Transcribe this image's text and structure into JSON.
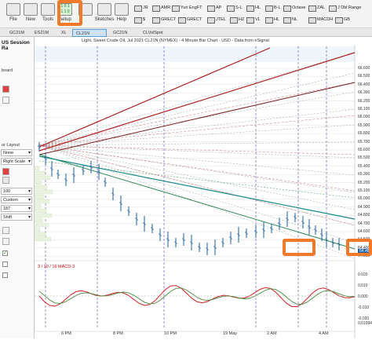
{
  "toolbar": {
    "buttons": [
      {
        "key": "file",
        "label": "File"
      },
      {
        "key": "new",
        "label": "New"
      },
      {
        "key": "tools",
        "label": "Tools"
      },
      {
        "key": "setup",
        "label": "Setup"
      },
      {
        "key": "sketch",
        "label": "Sketches"
      },
      {
        "key": "help",
        "label": "Help"
      }
    ],
    "tools_row1": [
      "JR",
      "AMR",
      "Yuri EngFT",
      "AP",
      "S-L",
      "HL",
      "B-L",
      "Octave",
      "ZAL",
      "J Dbl Range"
    ],
    "tools_row2": [
      "$",
      "GRECT",
      "GRECT",
      "JTEL",
      "HZ",
      "VL",
      "HL",
      "NL",
      "MACDH",
      "GB"
    ],
    "highlight_icon_text": "1 0 1\n1 1 0"
  },
  "tabs": [
    "GC21M",
    "ES21M",
    "XL",
    "CL21N",
    "GC21N",
    "CLVolSpot"
  ],
  "active_tab": "CL21N",
  "left_panel": {
    "title": "US Session Ra",
    "rows": [
      "board",
      "or Layout",
      "None",
      "Right Scale",
      "100",
      "Custom",
      "187",
      "Shift"
    ]
  },
  "chart": {
    "title": "Light, Sweet Crude Oil, Jul 2021 CL21N (NYMEX) - 4 Minute Bar Chart - USD - Data from eSignal",
    "price_labels": [
      "66.600",
      "66.500",
      "66.400",
      "66.300",
      "66.200",
      "66.100",
      "66.000",
      "65.900",
      "65.800",
      "65.700",
      "65.600",
      "65.500",
      "65.400",
      "65.300",
      "65.200",
      "65.100",
      "65.000",
      "64.900",
      "64.800",
      "64.700",
      "64.600",
      "64.500",
      "64.400",
      "64.300"
    ],
    "current_price": "64.48",
    "time_labels": [
      "6 PM",
      "8 PM",
      "10 PM",
      "19 May",
      "2 AM",
      "4 AM"
    ],
    "macd_label": "3 / 10 / 16 MACD-3",
    "macd_values": [
      "0.020",
      "0.010",
      "0.000",
      "-0.010",
      "-0.020"
    ],
    "macd_readout": "0.019940"
  },
  "colors": {
    "highlight": "#f07a2a",
    "price_line": "#1e5fa0",
    "red_fan": "#b02020",
    "green_fan": "#2e8b57",
    "teal_line": "#178a8a",
    "macd_red": "#d02020",
    "macd_green": "#4a8c3c"
  }
}
